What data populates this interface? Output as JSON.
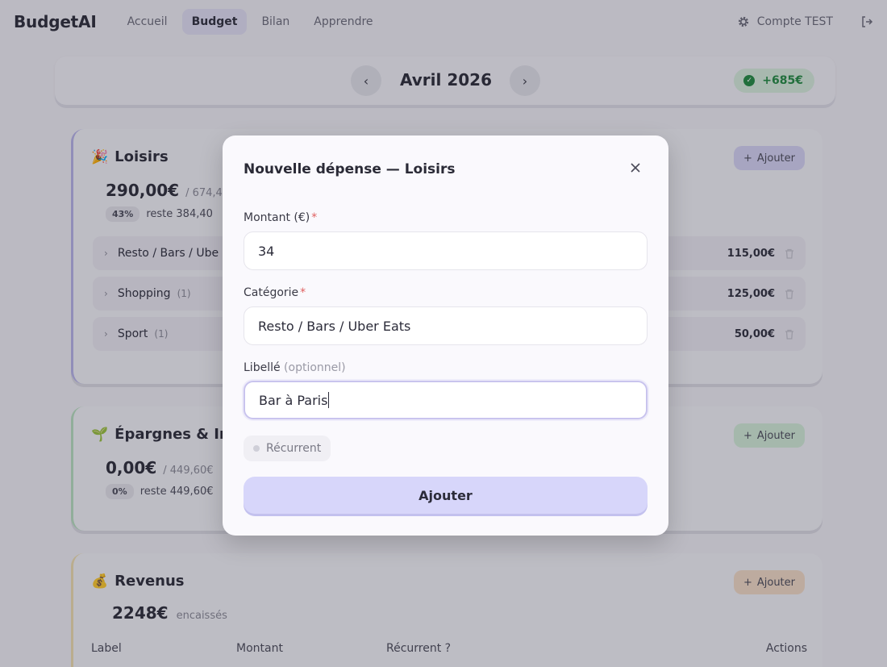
{
  "nav": {
    "brand": "BudgetAI",
    "links": [
      "Accueil",
      "Budget",
      "Bilan",
      "Apprendre"
    ],
    "account": "Compte TEST"
  },
  "month": {
    "title": "Avril 2026",
    "balance": "+685€"
  },
  "loisirs": {
    "emoji": "🎉",
    "title": "Loisirs",
    "add": "Ajouter",
    "spent": "290,00€",
    "of": "/ 674,4",
    "pct": "43%",
    "remaining": "reste 384,40",
    "rows": [
      {
        "label": "Resto / Bars / Ube",
        "count": "",
        "amount": "115,00€"
      },
      {
        "label": "Shopping",
        "count": "(1)",
        "amount": "125,00€"
      },
      {
        "label": "Sport",
        "count": "(1)",
        "amount": "50,00€"
      }
    ]
  },
  "epargne": {
    "emoji": "🌱",
    "title": "Épargnes & Inv",
    "add": "Ajouter",
    "spent": "0,00€",
    "of": "/ 449,60€",
    "pct": "0%",
    "remaining": "reste 449,60€"
  },
  "revenus": {
    "emoji": "💰",
    "title": "Revenus",
    "add": "Ajouter",
    "amount": "2248€",
    "caption": "encaissés",
    "columns": [
      "Label",
      "Montant",
      "Récurrent ?",
      "Actions"
    ]
  },
  "modal": {
    "title": "Nouvelle dépense — Loisirs",
    "amount_label": "Montant (€)",
    "amount_value": "34",
    "category_label": "Catégorie",
    "category_value": "Resto / Bars / Uber Eats",
    "label_label": "Libellé",
    "label_optional": "(optionnel)",
    "label_value": "Bar à Paris",
    "required_mark": "*",
    "recurrent": "Récurrent",
    "submit": "Ajouter"
  },
  "colors": {
    "accent": "#d7d6fa",
    "positive": "#1f8a3e"
  }
}
